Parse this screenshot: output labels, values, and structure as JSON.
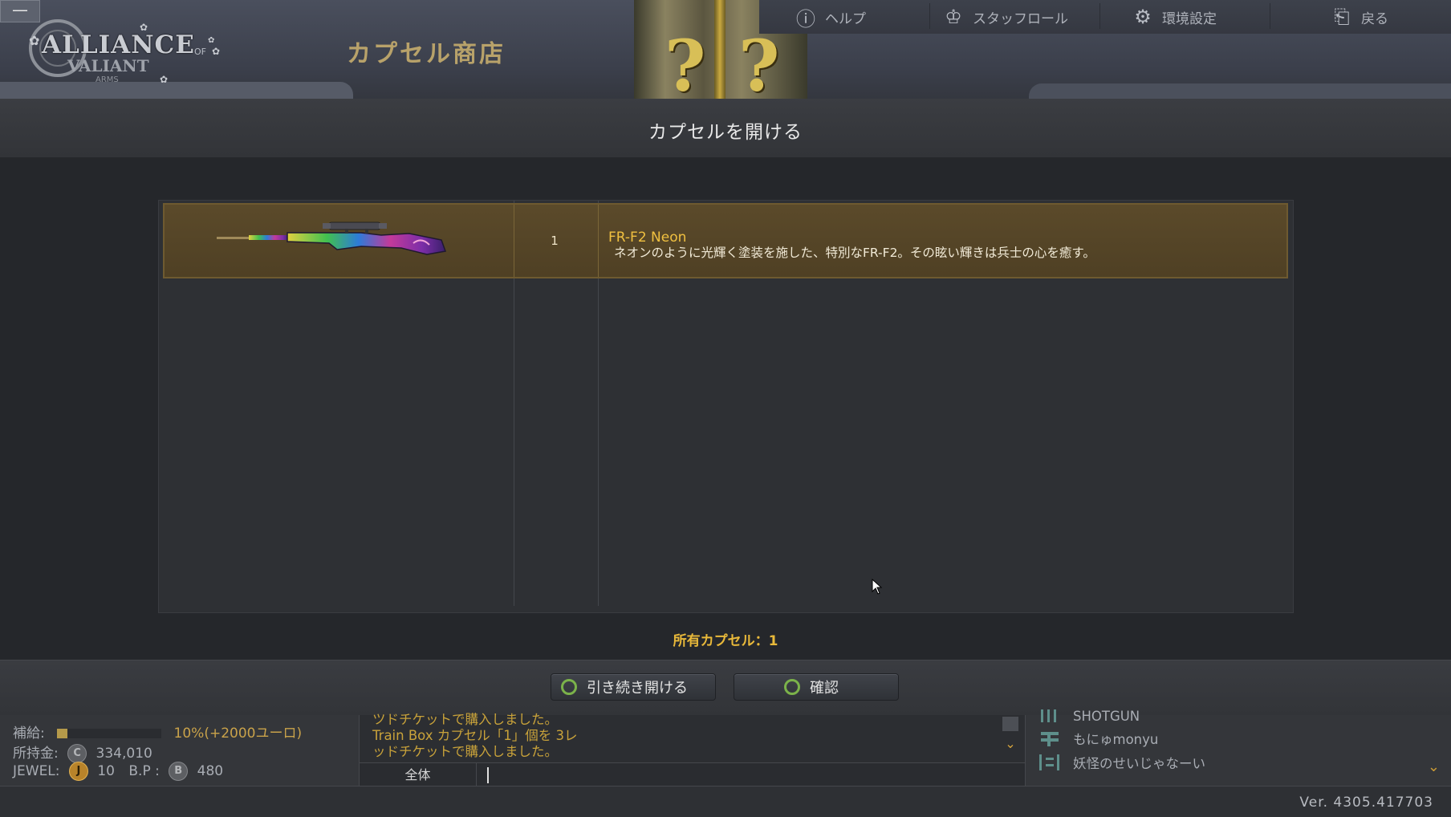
{
  "window": {
    "minimize_label": "—"
  },
  "logo": {
    "line1": "ALLIANCE",
    "of": "OF",
    "line2": "VALIANT",
    "line3": "ARMS"
  },
  "header": {
    "shop_title": "カプセル商店",
    "nav": [
      {
        "label": "ヘルプ",
        "icon": "help-icon"
      },
      {
        "label": "スタッフロール",
        "icon": "staff-roll-icon"
      },
      {
        "label": "環境設定",
        "icon": "gear-icon"
      },
      {
        "label": "戻る",
        "icon": "back-icon"
      }
    ]
  },
  "dialog": {
    "title": "カプセルを開ける",
    "items": [
      {
        "quantity": "1",
        "name": "FR-F2 Neon",
        "description": "ネオンのように光輝く塗装を施した、特別なFR-F2。その眩い輝きは兵士の心を癒す。"
      }
    ],
    "owned_capsules": "所有カプセル：1",
    "buttons": {
      "continue_open": "引き続き開ける",
      "confirm": "確認"
    }
  },
  "player": {
    "supply_label": "補給:",
    "supply_fraction": 0.1,
    "supply_text": "10%(+2000ユーロ)",
    "money_label": "所持金:",
    "money_coin": "C",
    "money_value": "334,010",
    "jewel_label": "JEWEL:",
    "jewel_coin": "J",
    "jewel_value": "10",
    "bp_label": "B.P :",
    "bp_coin": "B",
    "bp_value": "480"
  },
  "chat": {
    "lines": [
      "ツドチケットで購入しました。",
      "Train Box カプセル「1」個を 3レ",
      "ッドチケットで購入しました。"
    ],
    "channel": "全体",
    "input_value": ""
  },
  "friends": {
    "list": [
      {
        "name": "SHOTGUN"
      },
      {
        "name": "もにゅmonyu"
      },
      {
        "name": "妖怪のせいじゃなーい"
      }
    ]
  },
  "footer": {
    "version": "Ver. 4305.417703"
  }
}
